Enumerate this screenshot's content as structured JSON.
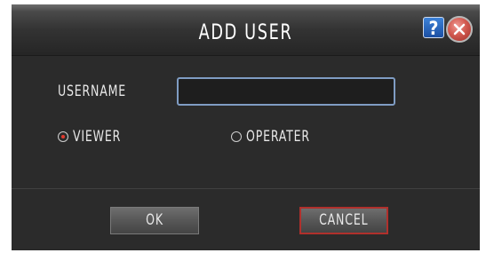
{
  "dialog": {
    "title": "ADD USER",
    "icons": {
      "help": "help-icon",
      "close": "close-icon"
    },
    "help_glyph": "?"
  },
  "form": {
    "username_label": "USERNAME",
    "username_value": "",
    "role_options": [
      {
        "label": "VIEWER",
        "selected": true
      },
      {
        "label": "OPERATER",
        "selected": false
      }
    ]
  },
  "buttons": {
    "ok_label": "OK",
    "cancel_label": "CANCEL"
  },
  "colors": {
    "dialog_bg": "#2b2b2b",
    "input_border": "#7f9cc3",
    "selected_radio": "#e23a2e",
    "focused_button_border": "#b0302c"
  }
}
